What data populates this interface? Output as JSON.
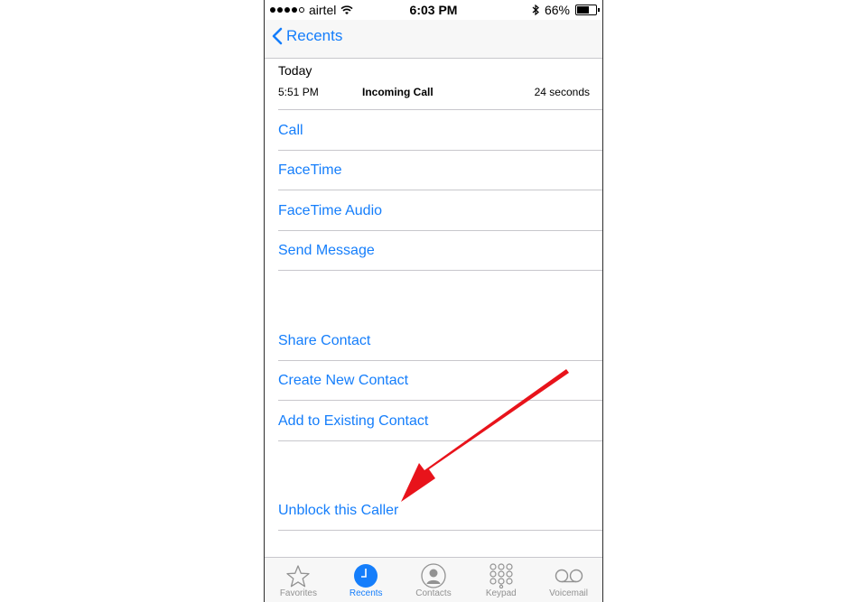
{
  "status": {
    "carrier": "airtel",
    "time": "6:03 PM",
    "battery": "66%",
    "battery_level": 0.66,
    "signal_bars": 4
  },
  "nav": {
    "back_label": "Recents"
  },
  "call_info": {
    "section": "Today",
    "time": "5:51 PM",
    "type": "Incoming Call",
    "duration": "24 seconds"
  },
  "actions": {
    "group1": [
      "Call",
      "FaceTime",
      "FaceTime Audio",
      "Send Message"
    ],
    "group2": [
      "Share Contact",
      "Create New Contact",
      "Add to Existing Contact"
    ],
    "group3": [
      "Unblock this Caller"
    ]
  },
  "tabs": [
    {
      "label": "Favorites",
      "icon": "star-icon",
      "active": false
    },
    {
      "label": "Recents",
      "icon": "clock-icon",
      "active": true
    },
    {
      "label": "Contacts",
      "icon": "person-icon",
      "active": false
    },
    {
      "label": "Keypad",
      "icon": "keypad-icon",
      "active": false
    },
    {
      "label": "Voicemail",
      "icon": "voicemail-icon",
      "active": false
    }
  ],
  "colors": {
    "accent": "#157efb",
    "annotation_arrow": "#e8131b"
  }
}
